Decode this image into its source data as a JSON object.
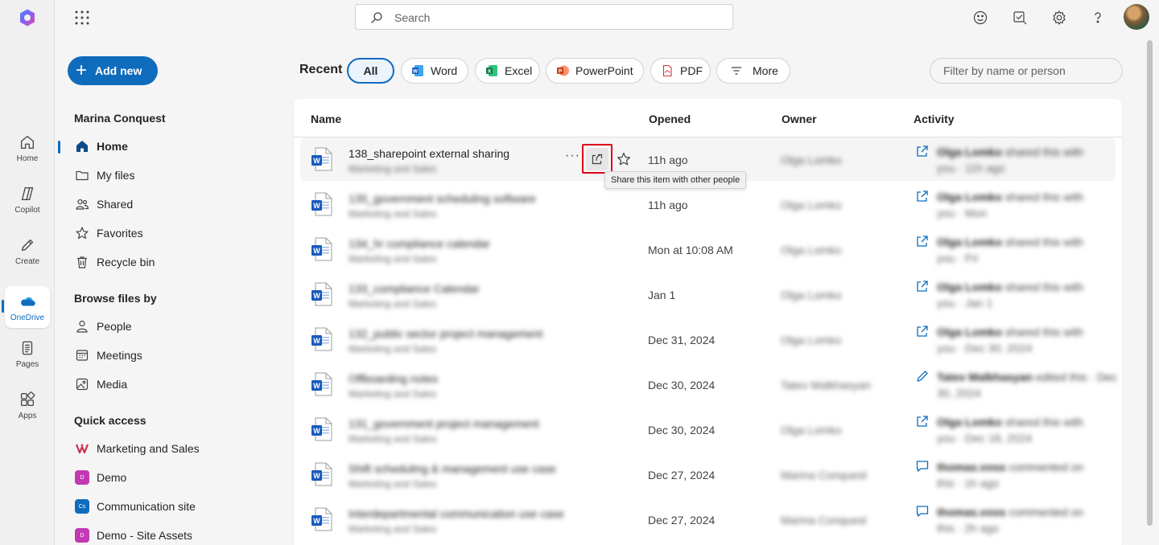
{
  "rail": {
    "items": [
      {
        "label": "Home",
        "icon": "home-icon"
      },
      {
        "label": "Copilot",
        "icon": "copilot-icon"
      },
      {
        "label": "Create",
        "icon": "pen-icon"
      },
      {
        "label": "OneDrive",
        "icon": "onedrive-icon"
      },
      {
        "label": "Pages",
        "icon": "pages-icon"
      },
      {
        "label": "Apps",
        "icon": "apps-icon"
      }
    ]
  },
  "topbar": {
    "search_placeholder": "Search"
  },
  "leftnav": {
    "add_new": "Add new",
    "user_name": "Marina Conquest",
    "items": [
      {
        "label": "Home",
        "icon": "home-icon"
      },
      {
        "label": "My files",
        "icon": "folder-icon"
      },
      {
        "label": "Shared",
        "icon": "people-icon"
      },
      {
        "label": "Favorites",
        "icon": "star-icon"
      },
      {
        "label": "Recycle bin",
        "icon": "trash-icon"
      }
    ],
    "browse_heading": "Browse files by",
    "browse_items": [
      {
        "label": "People",
        "icon": "person-icon"
      },
      {
        "label": "Meetings",
        "icon": "calendar-icon"
      },
      {
        "label": "Media",
        "icon": "image-icon"
      }
    ],
    "quick_heading": "Quick access",
    "quick_items": [
      {
        "label": "Marketing and Sales",
        "badge": "",
        "color": "#c4314b"
      },
      {
        "label": "Demo",
        "badge": "D",
        "color": "#c239b3"
      },
      {
        "label": "Communication site",
        "badge": "Cs",
        "color": "#0f6cbd"
      },
      {
        "label": "Demo - Site Assets",
        "badge": "D",
        "color": "#c239b3"
      }
    ]
  },
  "filters": {
    "recent_label": "Recent",
    "pills": [
      "All",
      "Word",
      "Excel",
      "PowerPoint",
      "PDF",
      "More"
    ],
    "filter_placeholder": "Filter by name or person"
  },
  "table": {
    "columns": [
      "Name",
      "Opened",
      "Owner",
      "Activity"
    ],
    "rows": [
      {
        "name": "138_sharepoint external sharing",
        "location": "Marketing and Sales",
        "opened": "11h ago",
        "owner": "Olga Lomko",
        "actor": "Olga Lomko",
        "action": " shared this with",
        "when": "you · 11h ago",
        "activity_icon": "share-icon"
      },
      {
        "name": "135_government scheduling software",
        "location": "Marketing and Sales",
        "opened": "11h ago",
        "owner": "Olga Lomko",
        "actor": "Olga Lomko",
        "action": " shared this with",
        "when": "you · Mon",
        "activity_icon": "share-icon"
      },
      {
        "name": "134_hr compliance calendar",
        "location": "Marketing and Sales",
        "opened": "Mon at 10:08 AM",
        "owner": "Olga Lomko",
        "actor": "Olga Lomko",
        "action": " shared this with",
        "when": "you · Fri",
        "activity_icon": "share-icon"
      },
      {
        "name": "133_compliance Calendar",
        "location": "Marketing and Sales",
        "opened": "Jan 1",
        "owner": "Olga Lomko",
        "actor": "Olga Lomko",
        "action": " shared this with",
        "when": "you · Jan 1",
        "activity_icon": "share-icon"
      },
      {
        "name": "132_public sector project management",
        "location": "Marketing and Sales",
        "opened": "Dec 31, 2024",
        "owner": "Olga Lomko",
        "actor": "Olga Lomko",
        "action": " shared this with",
        "when": "you · Dec 30, 2024",
        "activity_icon": "share-icon"
      },
      {
        "name": "Offboarding notes",
        "location": "Marketing and Sales",
        "opened": "Dec 30, 2024",
        "owner": "Tatev Malkhasyan",
        "actor": "Tatev Malkhasyan",
        "action": " edited this · Dec",
        "when": "30, 2024",
        "activity_icon": "pencil-icon"
      },
      {
        "name": "131_government project management",
        "location": "Marketing and Sales",
        "opened": "Dec 30, 2024",
        "owner": "Olga Lomko",
        "actor": "Olga Lomko",
        "action": " shared this with",
        "when": "you · Dec 18, 2024",
        "activity_icon": "share-icon"
      },
      {
        "name": "Shift scheduling & management use case",
        "location": "Marketing and Sales",
        "opened": "Dec 27, 2024",
        "owner": "Marina Conquest",
        "actor": "thomas.voss",
        "action": " commented on",
        "when": "this · 1h ago",
        "activity_icon": "comment-icon"
      },
      {
        "name": "Interdepartmental communication use case",
        "location": "Marketing and Sales",
        "opened": "Dec 27, 2024",
        "owner": "Marina Conquest",
        "actor": "thomas.voss",
        "action": " commented on",
        "when": "this · 2h ago",
        "activity_icon": "comment-icon"
      }
    ],
    "tooltip": "Share this item with other people",
    "more_dots": "···"
  },
  "colors": {
    "accent": "#0f6cbd",
    "highlight": "#e0001b"
  }
}
